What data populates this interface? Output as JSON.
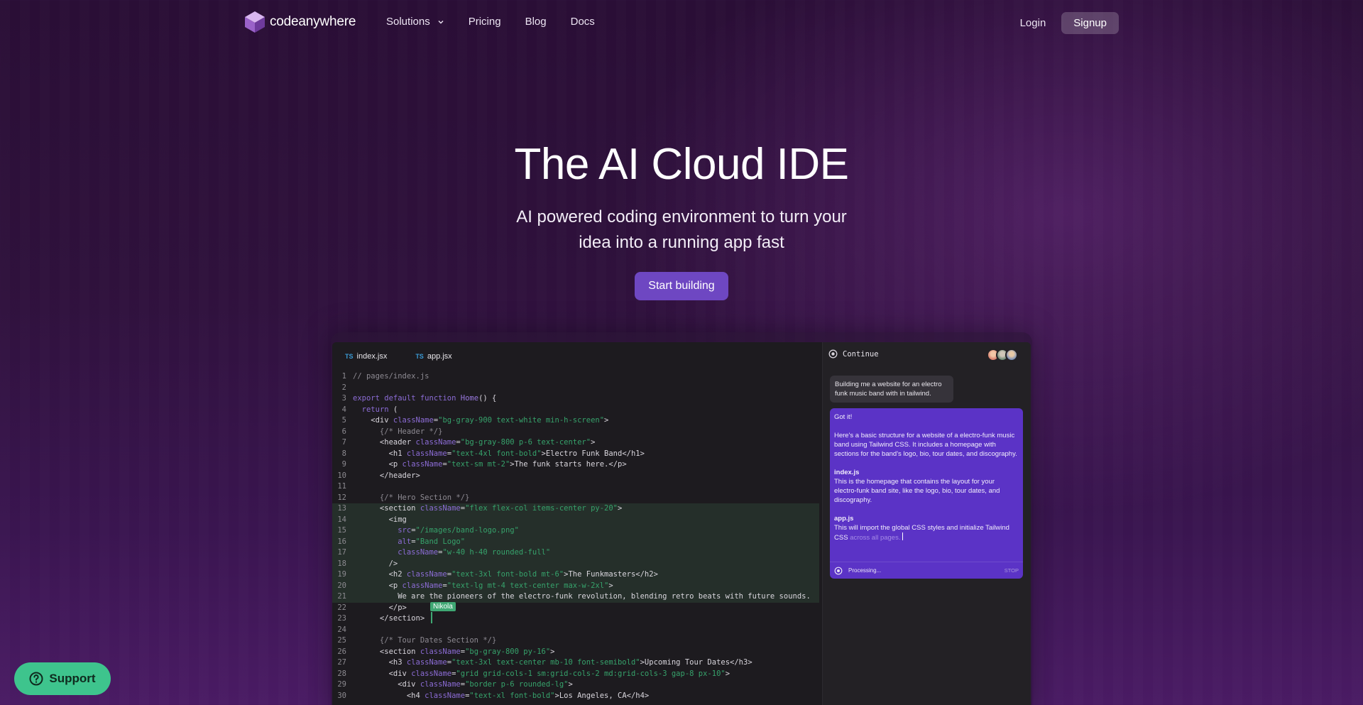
{
  "nav": {
    "brand": "codeanywhere",
    "links": [
      "Solutions",
      "Pricing",
      "Blog",
      "Docs"
    ],
    "login": "Login",
    "signup": "Signup"
  },
  "hero": {
    "title": "The AI Cloud IDE",
    "subtitle_line1": "AI powered coding environment to turn your",
    "subtitle_line2": "idea into a running app fast",
    "cta": "Start building"
  },
  "editor": {
    "tabs": [
      {
        "badge": "TS",
        "name": "index.jsx"
      },
      {
        "badge": "TS",
        "name": "app.jsx"
      }
    ],
    "collaborator": "Nikola",
    "lines": [
      "// pages/index.js",
      "",
      "export default function Home() {",
      "  return (",
      "    <div className=\"bg-gray-900 text-white min-h-screen\">",
      "      {/* Header */}",
      "      <header className=\"bg-gray-800 p-6 text-center\">",
      "        <h1 className=\"text-4xl font-bold\">Electro Funk Band</h1>",
      "        <p className=\"text-sm mt-2\">The funk starts here.</p>",
      "      </header>",
      "",
      "      {/* Hero Section */}",
      "      <section className=\"flex flex-col items-center py-20\">",
      "        <img",
      "          src=\"/images/band-logo.png\"",
      "          alt=\"Band Logo\"",
      "          className=\"w-40 h-40 rounded-full\"",
      "        />",
      "        <h2 className=\"text-3xl font-bold mt-6\">The Funkmasters</h2>",
      "        <p className=\"text-lg mt-4 text-center max-w-2xl\">",
      "          We are the pioneers of the electro-funk revolution, blending retro beats with future sounds.",
      "        </p>",
      "      </section>",
      "",
      "      {/* Tour Dates Section */}",
      "      <section className=\"bg-gray-800 py-16\">",
      "        <h3 className=\"text-3xl text-center mb-10 font-semibold\">Upcoming Tour Dates</h3>",
      "        <div className=\"grid grid-cols-1 sm:grid-cols-2 md:grid-cols-3 gap-8 px-10\">",
      "          <div className=\"border p-6 rounded-lg\">",
      "            <h4 className=\"text-xl font-bold\">Los Angeles, CA</h4>"
    ]
  },
  "chat": {
    "title": "Continue",
    "user_message": "Building me a website for an electro funk music band with in tailwind.",
    "ai_intro": "Got it!",
    "ai_body": "Here's a basic structure for a website of a electro-funk music band using Tailwind CSS. It includes a homepage with sections for the band's logo, bio, tour dates, and discography.",
    "file1_name": "index.js",
    "file1_desc": "This is the homepage that contains the layout for your electro-funk band site, like the logo, bio, tour dates, and discography.",
    "file2_name": "app.js",
    "file2_desc": "This will import the global CSS styles and initialize Tailwind CSS",
    "file2_desc_fade": "across all pages.",
    "status": "Processing...",
    "stop": "STOP"
  },
  "support": {
    "label": "Support"
  },
  "colors": {
    "accent": "#6e47c2",
    "support": "#3ec48d",
    "chat_bubble": "#5b33c6"
  }
}
